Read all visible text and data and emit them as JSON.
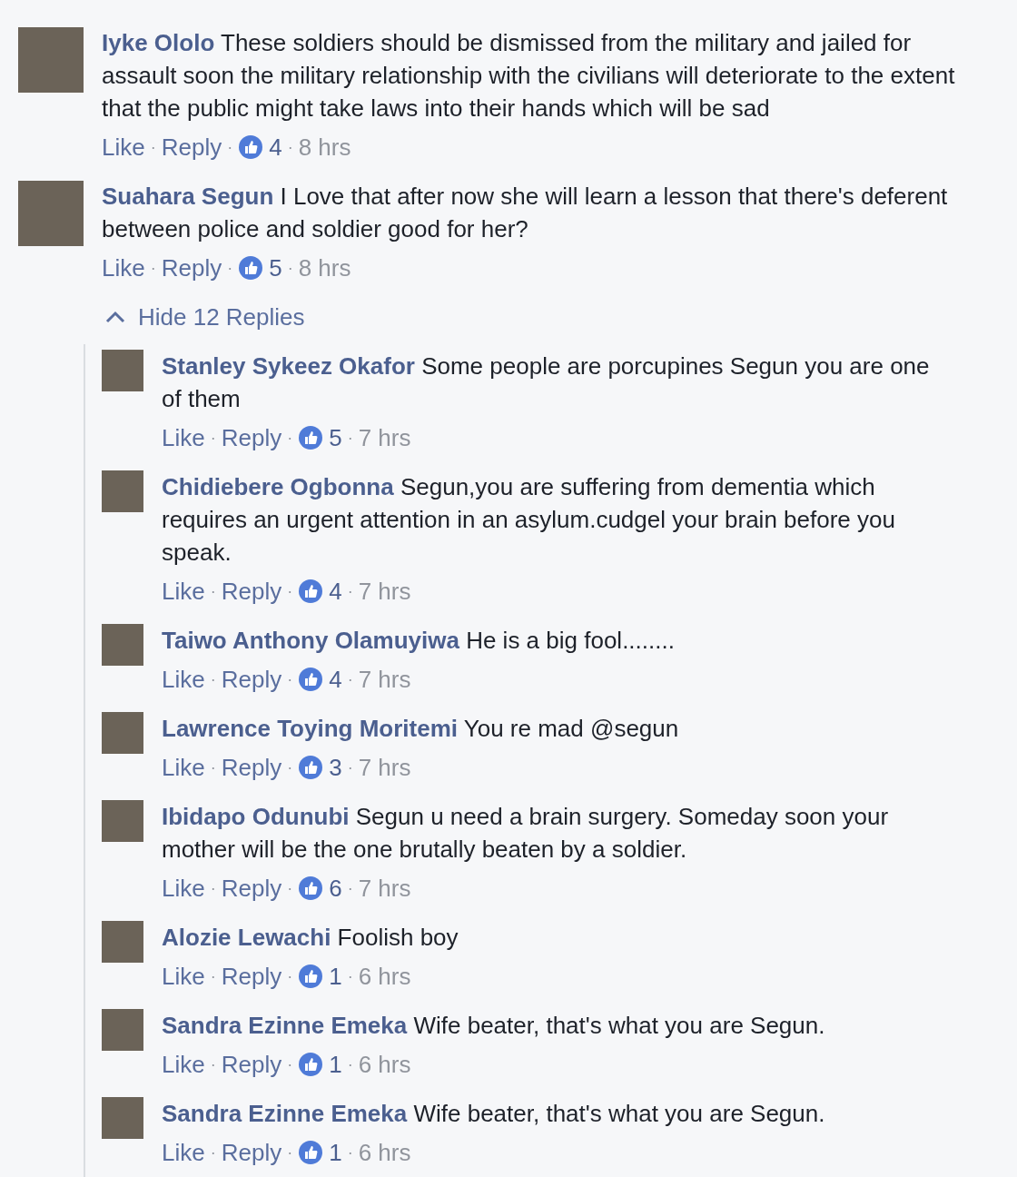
{
  "separator": "·",
  "comments": [
    {
      "author": "Iyke Ololo",
      "text": "These soldiers should be dismissed from the military and jailed for assault soon the military relationship with the civilians will deteriorate to the extent that the public might take laws into their hands which will be sad",
      "actions": [
        "Like",
        "Reply"
      ],
      "likes": "4",
      "time": "8 hrs"
    },
    {
      "author": "Suahara Segun",
      "text": "I Love that after now she will learn a lesson that there's deferent between police and soldier good for her?",
      "actions": [
        "Like",
        "Reply"
      ],
      "likes": "5",
      "time": "8 hrs",
      "replies_toggle": {
        "label": "Hide 12 Replies",
        "expanded": true
      },
      "replies": [
        {
          "author": "Stanley Sykeez Okafor",
          "text": "Some people are porcupines Segun you are one of them",
          "actions": [
            "Like",
            "Reply"
          ],
          "likes": "5",
          "time": "7 hrs"
        },
        {
          "author": "Chidiebere Ogbonna",
          "text": "Segun,you are suffering from dementia which requires an urgent attention in an asylum.cudgel your brain before you speak.",
          "actions": [
            "Like",
            "Reply"
          ],
          "likes": "4",
          "time": "7 hrs"
        },
        {
          "author": "Taiwo Anthony Olamuyiwa",
          "text": "He is a big fool........",
          "actions": [
            "Like",
            "Reply"
          ],
          "likes": "4",
          "time": "7 hrs"
        },
        {
          "author": "Lawrence Toying Moritemi",
          "text": "You re mad @segun",
          "actions": [
            "Like",
            "Reply"
          ],
          "likes": "3",
          "time": "7 hrs"
        },
        {
          "author": "Ibidapo Odunubi",
          "text": "Segun u need a brain surgery. Someday soon your mother will be the one brutally beaten by a soldier.",
          "actions": [
            "Like",
            "Reply"
          ],
          "likes": "6",
          "time": "7 hrs"
        },
        {
          "author": "Alozie Lewachi",
          "text": "Foolish boy",
          "actions": [
            "Like",
            "Reply"
          ],
          "likes": "1",
          "time": "6 hrs"
        },
        {
          "author": "Sandra Ezinne Emeka",
          "text": "Wife beater, that's what you are Segun.",
          "actions": [
            "Like",
            "Reply"
          ],
          "likes": "1",
          "time": "6 hrs"
        },
        {
          "author": "Sandra Ezinne Emeka",
          "text": "Wife beater, that's what you are Segun.",
          "actions": [
            "Like",
            "Reply"
          ],
          "likes": "1",
          "time": "6 hrs"
        }
      ]
    }
  ]
}
